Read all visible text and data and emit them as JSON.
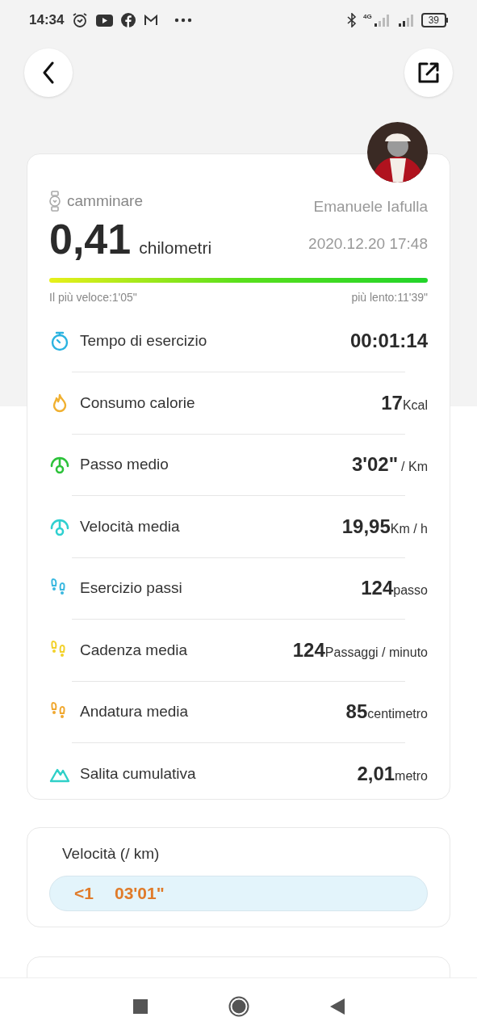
{
  "status_bar": {
    "time": "14:34",
    "network": "4G",
    "battery": "39"
  },
  "workout": {
    "activity": "camminare",
    "distance": "0,41",
    "distance_unit": "chilometri",
    "user": "Emanuele Iafulla",
    "datetime": "2020.12.20 17:48",
    "fastest": "Il più veloce:1'05\"",
    "slowest": "più lento:11'39\""
  },
  "metrics": [
    {
      "kind": "stopwatch",
      "color": "#2bb3e0",
      "label": "Tempo di esercizio",
      "value": "00:01:14"
    },
    {
      "kind": "flame",
      "color": "#f0b030",
      "label": "Consumo calorie",
      "value": "17",
      "unit": "Kcal"
    },
    {
      "kind": "gauge",
      "color": "#2cc23a",
      "label": "Passo medio",
      "value": "3'02\"",
      "unit": "/ Km"
    },
    {
      "kind": "gauge",
      "color": "#2fd0d0",
      "label": "Velocità media",
      "value": "19,95",
      "unit": "Km / h"
    },
    {
      "kind": "footprints",
      "color": "#3ab8e0",
      "label": "Esercizio passi",
      "value": "124",
      "unit": "passo"
    },
    {
      "kind": "footprints",
      "color": "#f2d12a",
      "label": "Cadenza media",
      "value": "124",
      "unit": "Passaggi / minuto"
    },
    {
      "kind": "footprints",
      "color": "#f0a830",
      "label": "Andatura media",
      "value": "85",
      "unit": "centimetro"
    },
    {
      "kind": "mountain",
      "color": "#2fd0c8",
      "label": "Salita cumulativa",
      "value": "2,01",
      "unit": "metro"
    }
  ],
  "speed_card": {
    "title": "Velocità (/ km)",
    "splits": [
      {
        "km": "<1",
        "pace": "03'01\""
      }
    ]
  }
}
